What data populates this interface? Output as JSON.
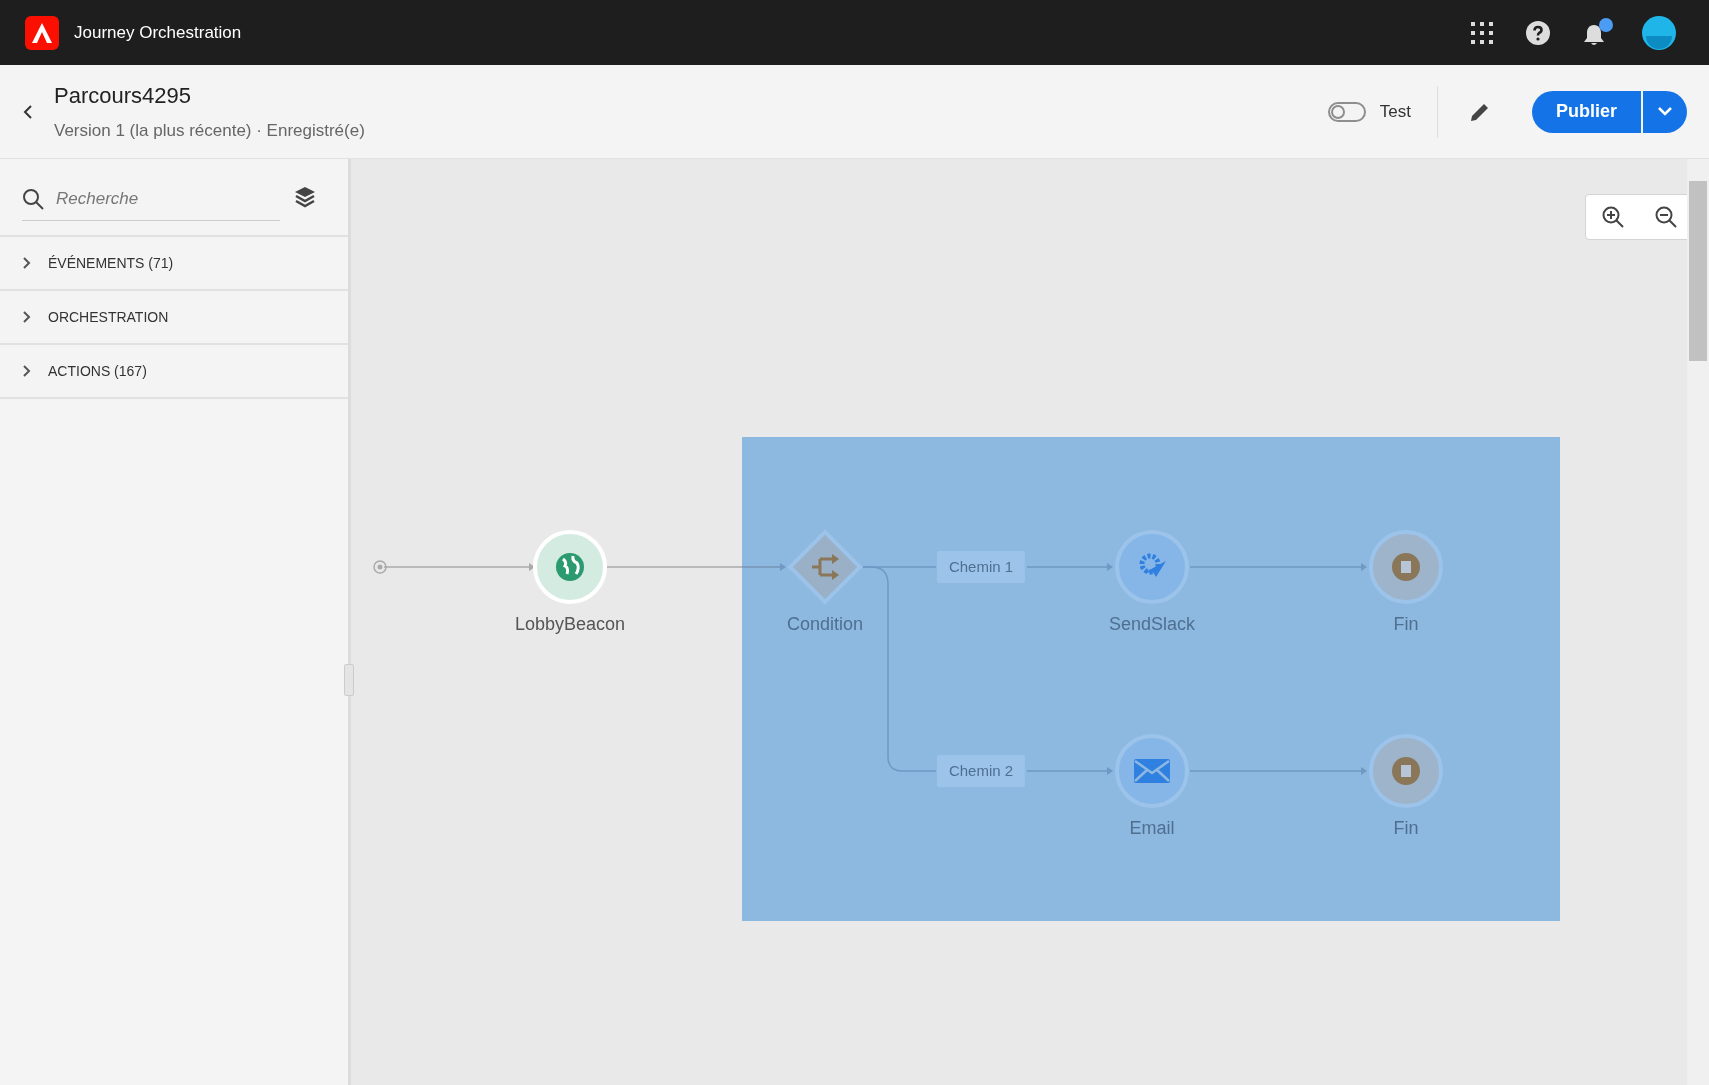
{
  "app": {
    "title": "Journey Orchestration"
  },
  "notifications": {
    "unread": true
  },
  "journey": {
    "title": "Parcours4295",
    "subtitle": "Version 1 (la plus récente) · Enregistré(e)"
  },
  "test_toggle": {
    "label": "Test",
    "on": false
  },
  "publish_button": {
    "label": "Publier"
  },
  "sidebar": {
    "search": {
      "placeholder": "Recherche"
    },
    "sections": [
      {
        "label": "ÉVÉNEMENTS (71)",
        "expanded": false
      },
      {
        "label": "ORCHESTRATION",
        "expanded": false
      },
      {
        "label": "ACTIONS (167)",
        "expanded": false
      }
    ]
  },
  "canvas": {
    "selection": true,
    "nodes": [
      {
        "kind": "event",
        "label": "LobbyBeacon",
        "selected": false
      },
      {
        "kind": "condition",
        "label": "Condition",
        "selected": true
      },
      {
        "kind": "action",
        "label": "SendSlack",
        "selected": true
      },
      {
        "kind": "end",
        "label": "Fin",
        "selected": true
      },
      {
        "kind": "email",
        "label": "Email",
        "selected": true
      },
      {
        "kind": "end",
        "label": "Fin",
        "selected": true
      }
    ],
    "paths": [
      {
        "label": "Chemin 1"
      },
      {
        "label": "Chemin 2"
      }
    ]
  }
}
